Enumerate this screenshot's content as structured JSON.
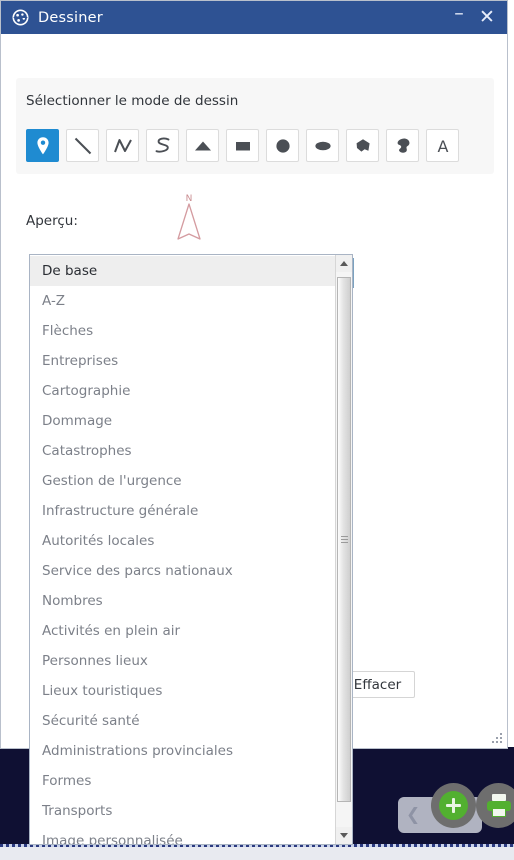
{
  "window": {
    "title": "Dessiner",
    "icon": "palette-icon",
    "minimize_label": "–",
    "close_label": "✕",
    "titlebar_color": "#2e5293"
  },
  "mode_panel": {
    "label": "Sélectionner le mode de dessin",
    "active_tool_color": "#1f8bd1",
    "tools": [
      {
        "name": "point-tool",
        "icon": "map-pin-icon",
        "active": true
      },
      {
        "name": "line-tool",
        "icon": "line-icon",
        "active": false
      },
      {
        "name": "polyline-tool",
        "icon": "polyline-icon",
        "active": false
      },
      {
        "name": "freehand-line-tool",
        "icon": "freehand-line-icon",
        "active": false
      },
      {
        "name": "triangle-tool",
        "icon": "triangle-icon",
        "active": false
      },
      {
        "name": "rectangle-tool",
        "icon": "rectangle-icon",
        "active": false
      },
      {
        "name": "circle-tool",
        "icon": "circle-icon",
        "active": false
      },
      {
        "name": "ellipse-tool",
        "icon": "ellipse-icon",
        "active": false
      },
      {
        "name": "polygon-tool",
        "icon": "polygon-icon",
        "active": false
      },
      {
        "name": "freehand-polygon-tool",
        "icon": "freehand-polygon-icon",
        "active": false
      },
      {
        "name": "text-tool",
        "icon": "text-a-icon",
        "active": false
      }
    ]
  },
  "preview": {
    "label": "Aperçu:",
    "symbol": "north-arrow-icon",
    "symbol_letter": "N",
    "symbol_color": "#c98c90"
  },
  "category_select": {
    "value": "De base",
    "caret": "chevron-down-icon",
    "options": [
      "De base",
      "A-Z",
      "Flèches",
      "Entreprises",
      "Cartographie",
      "Dommage",
      "Catastrophes",
      "Gestion de l'urgence",
      "Infrastructure générale",
      "Autorités locales",
      "Service des parcs nationaux",
      "Nombres",
      "Activités en plein air",
      "Personnes lieux",
      "Lieux touristiques",
      "Sécurité santé",
      "Administrations provinciales",
      "Formes",
      "Transports",
      "Image personnalisée"
    ],
    "selected_index": 0,
    "scroll_up_icon": "triangle-up-icon",
    "scroll_down_icon": "triangle-down-icon"
  },
  "actions": {
    "clear_label": "Effacer"
  },
  "background": {
    "collapse_icon": "chevron-left-icon",
    "add_button_icon": "plus-circle-icon",
    "print_button_icon": "printer-icon",
    "accent_green": "#52b030",
    "panel_color": "#0f1033"
  }
}
